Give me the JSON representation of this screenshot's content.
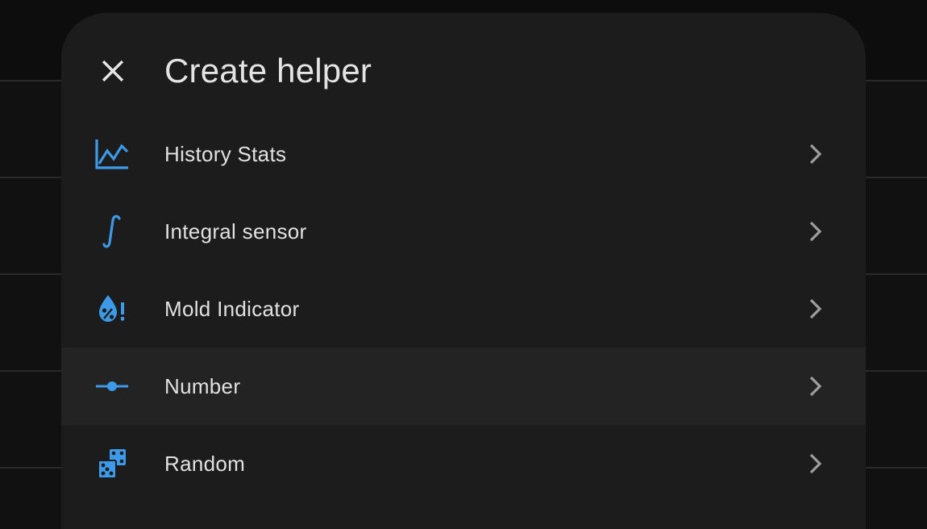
{
  "dialog": {
    "title": "Create helper",
    "close_icon": "close-icon",
    "accent_color": "#3d9ae8"
  },
  "items": [
    {
      "label": "History Stats",
      "icon": "chart-line-icon"
    },
    {
      "label": "Integral sensor",
      "icon": "integral-icon"
    },
    {
      "label": "Mold Indicator",
      "icon": "water-percent-alert-icon"
    },
    {
      "label": "Number",
      "icon": "slider-icon",
      "hovered": true
    },
    {
      "label": "Random",
      "icon": "dice-icon"
    }
  ]
}
